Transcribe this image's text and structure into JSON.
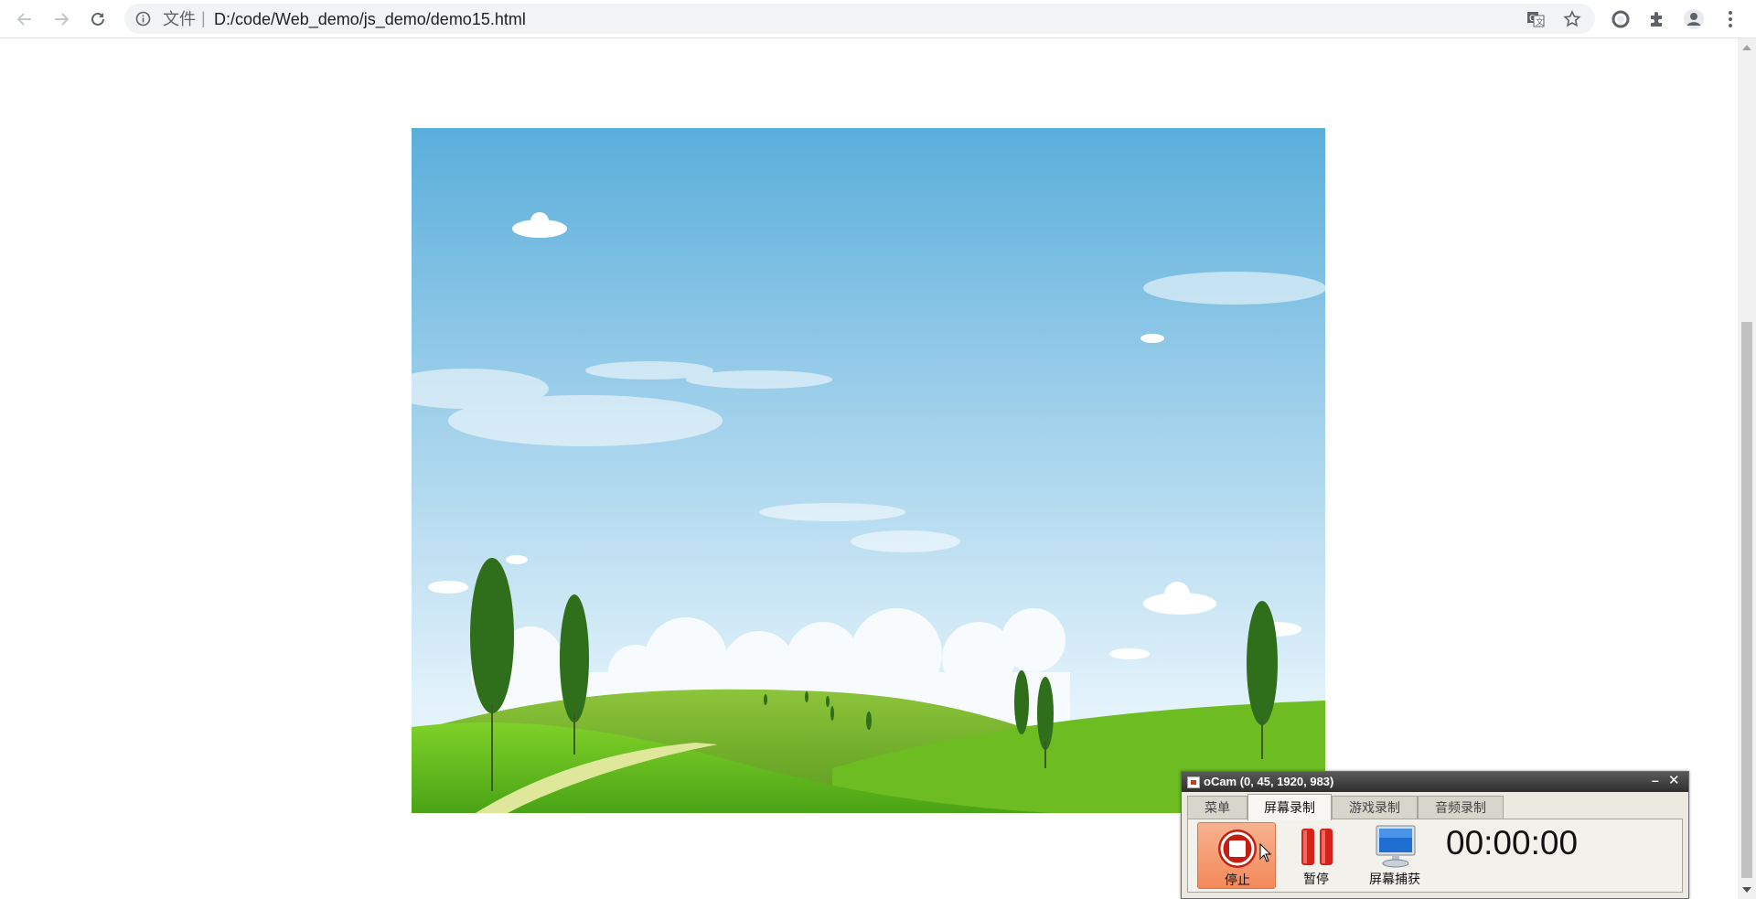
{
  "browser": {
    "address": {
      "scheme_label": "文件",
      "separator": "|",
      "url": "D:/code/Web_demo/js_demo/demo15.html"
    },
    "icons": [
      "back-icon",
      "forward-icon",
      "reload-icon",
      "info-icon",
      "translate-icon",
      "bookmark-star-icon",
      "extension-circle-icon",
      "extensions-puzzle-icon",
      "profile-icon",
      "menu-dots-icon"
    ]
  },
  "page": {
    "image_description_name": "landscape-image"
  },
  "ocam": {
    "title": "oCam (0, 45, 1920, 983)",
    "minimize": "–",
    "close": "✕",
    "tabs": [
      {
        "label": "菜单"
      },
      {
        "label": "屏幕录制"
      },
      {
        "label": "游戏录制"
      },
      {
        "label": "音频录制"
      }
    ],
    "active_tab": "屏幕录制",
    "buttons": {
      "stop_label": "停止",
      "pause_label": "暂停",
      "capture_label": "屏幕捕获"
    },
    "timer": "00:00:00",
    "colors": {
      "title_bar": "#3a3a3a",
      "stop_button": "#f4895a"
    }
  }
}
